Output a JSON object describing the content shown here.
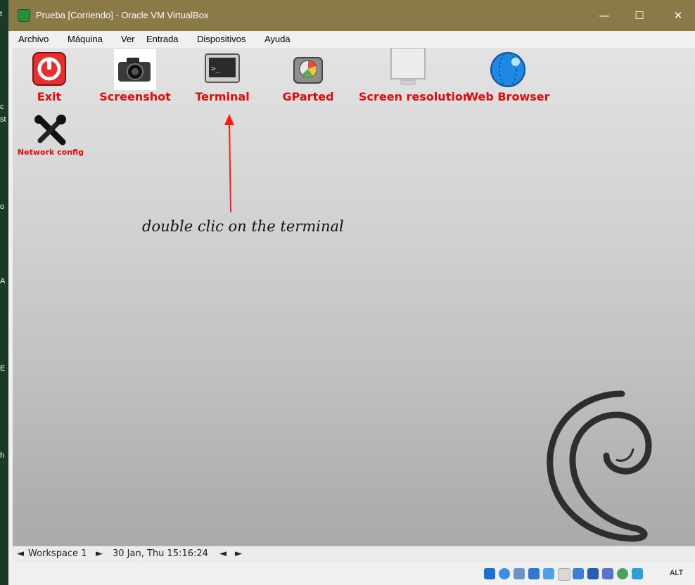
{
  "window": {
    "title": "Prueba [Corriendo] - Oracle VM VirtualBox",
    "controls": {
      "minimize": "—",
      "maximize": "☐",
      "close": "✕"
    }
  },
  "menu": [
    "Archivo",
    "Máquina",
    "Ver",
    "Entrada",
    "Dispositivos",
    "Ayuda"
  ],
  "desktop_icons": [
    {
      "label": "Exit"
    },
    {
      "label": "Screenshot"
    },
    {
      "label": "Terminal"
    },
    {
      "label": "GParted"
    },
    {
      "label": "Screen resolution"
    },
    {
      "label": "Web Browser"
    },
    {
      "label": "Network config"
    }
  ],
  "annotation": "double clic on the terminal",
  "taskbar": {
    "prev_workspace": "◄",
    "workspace": "Workspace 1",
    "next_workspace": "►",
    "datetime": "30 Jan, Thu 15:16:24",
    "prev": "◄",
    "next": "►"
  },
  "statusbar": {
    "host_key": "ALT"
  },
  "host_strip_letters": [
    "t",
    "c",
    "st",
    "o",
    "A",
    "E",
    "h"
  ],
  "colors": {
    "label_red": "#e20b0b",
    "titlebar": "#8a7a47"
  }
}
